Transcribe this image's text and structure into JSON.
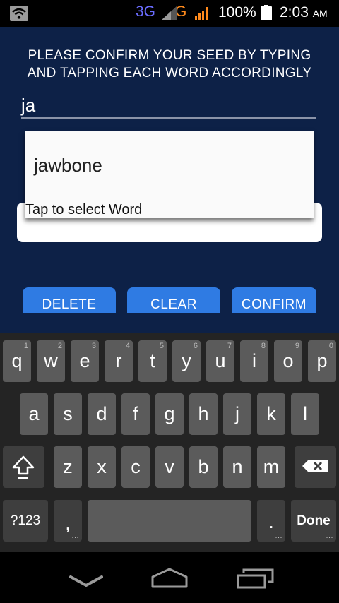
{
  "status": {
    "network_3g": "3G",
    "network_g": "G",
    "battery": "100%",
    "time": "2:03",
    "ampm": "AM"
  },
  "screen": {
    "instruction": "PLEASE CONFIRM YOUR SEED BY TYPING AND TAPPING EACH WORD ACCORDINGLY",
    "input_value": "ja",
    "suggestion": "jawbone",
    "tap_hint": "Tap to select Word",
    "buttons": {
      "delete": "DELETE",
      "clear": "CLEAR",
      "confirm": "CONFIRM"
    }
  },
  "keyboard": {
    "row1": [
      {
        "k": "q",
        "h": "1"
      },
      {
        "k": "w",
        "h": "2"
      },
      {
        "k": "e",
        "h": "3"
      },
      {
        "k": "r",
        "h": "4"
      },
      {
        "k": "t",
        "h": "5"
      },
      {
        "k": "y",
        "h": "6"
      },
      {
        "k": "u",
        "h": "7"
      },
      {
        "k": "i",
        "h": "8"
      },
      {
        "k": "o",
        "h": "9"
      },
      {
        "k": "p",
        "h": "0"
      }
    ],
    "row2": [
      "a",
      "s",
      "d",
      "f",
      "g",
      "h",
      "j",
      "k",
      "l"
    ],
    "row3": [
      "z",
      "x",
      "c",
      "v",
      "b",
      "n",
      "m"
    ],
    "symbols": "?123",
    "comma": ",",
    "period": ".",
    "done": "Done"
  },
  "icons": {
    "wifi": "wifi-icon",
    "signal": "signal-icon",
    "battery": "battery-icon",
    "shift": "shift-icon",
    "backspace": "backspace-icon",
    "back": "back-icon",
    "home": "home-icon",
    "recents": "recents-icon"
  },
  "colors": {
    "app_bg": "#0d2147",
    "button": "#2f7be3",
    "keyboard_bg": "#242424"
  }
}
